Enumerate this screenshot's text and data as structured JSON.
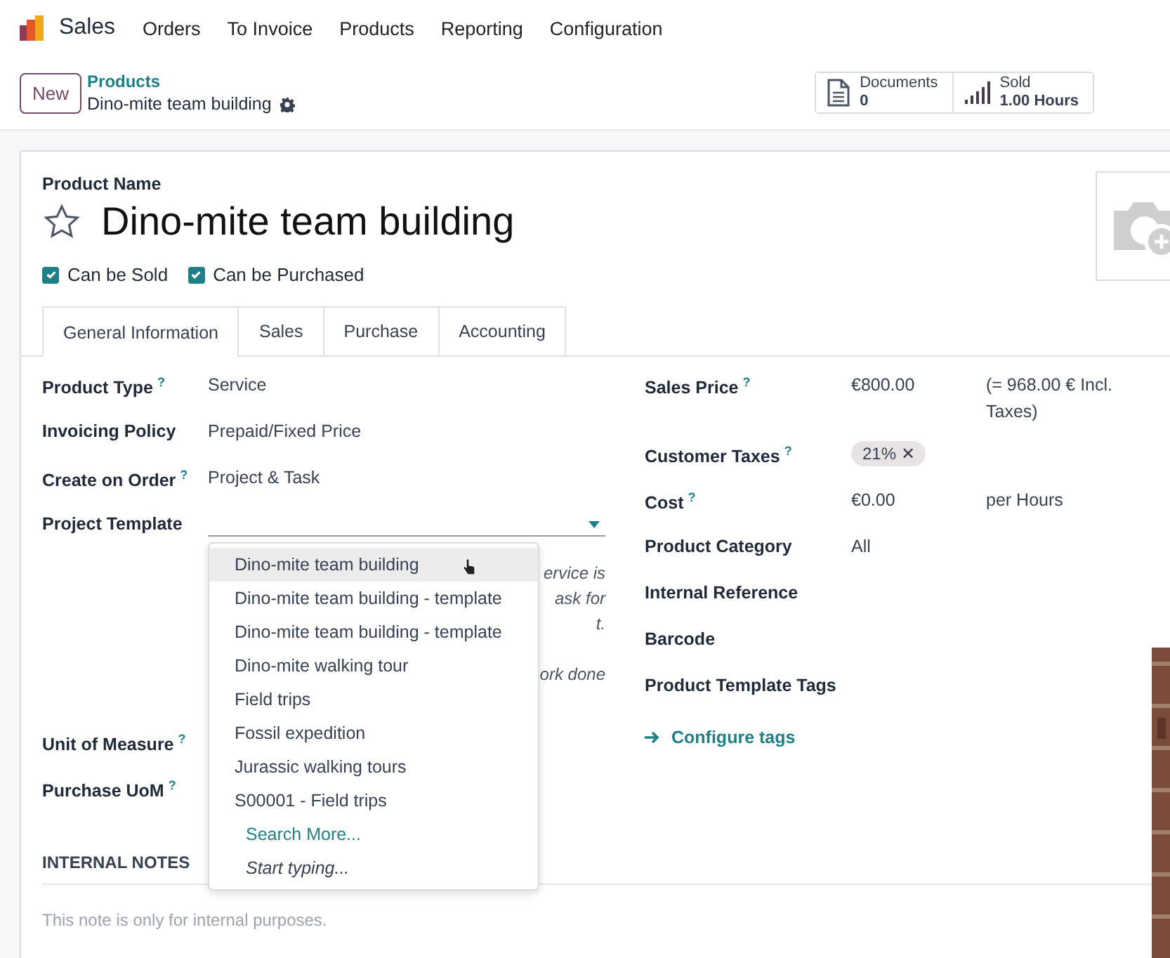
{
  "app": {
    "name": "Sales"
  },
  "menu": [
    {
      "label": "Orders"
    },
    {
      "label": "To Invoice"
    },
    {
      "label": "Products"
    },
    {
      "label": "Reporting"
    },
    {
      "label": "Configuration"
    }
  ],
  "new_button": "New",
  "breadcrumb": {
    "parent": "Products",
    "current": "Dino-mite team building"
  },
  "smart_buttons": [
    {
      "kind": "documents",
      "label": "Documents",
      "value": "0"
    },
    {
      "kind": "sold",
      "label": "Sold",
      "value": "1.00 Hours"
    }
  ],
  "product": {
    "name_label": "Product Name",
    "name": "Dino-mite team building",
    "favorite": false
  },
  "checkboxes": [
    {
      "label": "Can be Sold",
      "checked": true
    },
    {
      "label": "Can be Purchased",
      "checked": true
    }
  ],
  "tabs": [
    {
      "label": "General Information",
      "selected": true
    },
    {
      "label": "Sales",
      "selected": false
    },
    {
      "label": "Purchase",
      "selected": false
    },
    {
      "label": "Accounting",
      "selected": false
    }
  ],
  "left_fields": [
    {
      "kind": "text",
      "label": "Product Type",
      "help": "?",
      "value": "Service"
    },
    {
      "kind": "text",
      "label": "Invoicing Policy",
      "value": "Prepaid/Fixed Price"
    },
    {
      "kind": "text",
      "label": "Create on Order",
      "help": "?",
      "value": "Project & Task"
    },
    {
      "kind": "select",
      "label": "Project Template"
    },
    {
      "kind": "note",
      "lines": [
        "ervice is",
        "ask for",
        "t.",
        "ork done"
      ]
    },
    {
      "kind": "text",
      "label": "Unit of Measure",
      "help": "?"
    },
    {
      "kind": "text",
      "label": "Purchase UoM",
      "help": "?"
    }
  ],
  "dropdown": {
    "options": [
      {
        "label": "Dino-mite team building",
        "hovered": true
      },
      {
        "label": "Dino-mite team building - template",
        "hovered": false
      },
      {
        "label": "Dino-mite team building - template",
        "hovered": false
      },
      {
        "label": "Dino-mite walking tour",
        "hovered": false
      },
      {
        "label": "Field trips",
        "hovered": false
      },
      {
        "label": "Fossil expedition",
        "hovered": false
      },
      {
        "label": "Jurassic walking tours",
        "hovered": false
      },
      {
        "label": "S00001 - Field trips",
        "hovered": false
      }
    ],
    "search_more": "Search More...",
    "start_typing": "Start typing..."
  },
  "right_fields": [
    {
      "kind": "text",
      "label": "Sales Price",
      "help": "?",
      "value": "€800.00",
      "extra": "(= 968.00 € Incl. Taxes)"
    },
    {
      "kind": "tags",
      "label": "Customer Taxes",
      "help": "?",
      "tags": [
        {
          "label": "21%",
          "remove": "✕"
        }
      ]
    },
    {
      "kind": "text",
      "label": "Cost",
      "help": "?",
      "value": "€0.00",
      "extra": "per Hours"
    },
    {
      "kind": "text",
      "label": "Product Category",
      "value": "All"
    },
    {
      "kind": "text",
      "label": "Internal Reference"
    },
    {
      "kind": "text",
      "label": "Barcode"
    },
    {
      "kind": "text",
      "label": "Product Template Tags"
    }
  ],
  "configure_tags": "Configure tags",
  "notes": {
    "title": "INTERNAL NOTES",
    "placeholder": "This note is only for internal purposes."
  }
}
